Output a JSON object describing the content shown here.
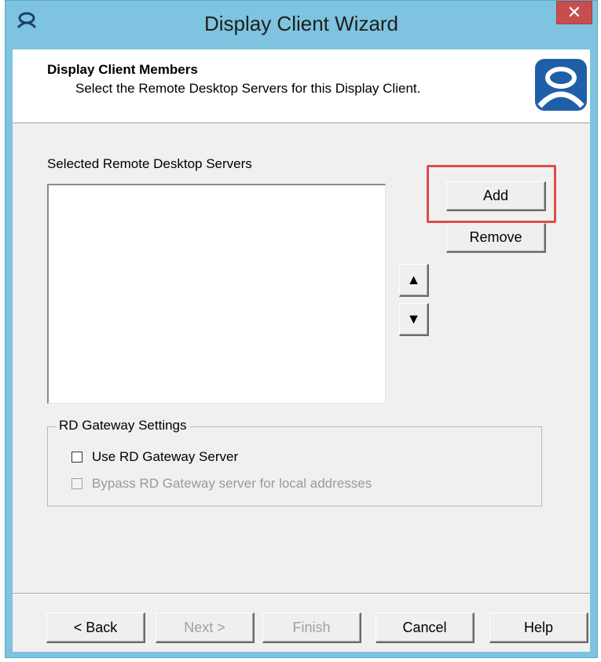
{
  "window": {
    "title": "Display Client Wizard",
    "close_symbol": "✕",
    "app_icon": "thinmanager-icon",
    "close_color": "#c74e4e",
    "titlebar_color": "#7ec3df"
  },
  "header": {
    "title": "Display Client Members",
    "subtitle": "Select the Remote Desktop Servers for this Display Client.",
    "logo": "thinmanager-logo"
  },
  "servers": {
    "label": "Selected Remote Desktop Servers",
    "items": []
  },
  "buttons": {
    "add": "Add",
    "remove": "Remove",
    "move_up": "▲",
    "move_down": "▼"
  },
  "highlight": {
    "target": "add-button",
    "color": "#e04a4a"
  },
  "gateway": {
    "label": "RD Gateway Settings",
    "use_gateway": {
      "label": "Use RD Gateway Server",
      "checked": false,
      "enabled": true
    },
    "bypass_local": {
      "label": "Bypass RD Gateway server for local addresses",
      "checked": false,
      "enabled": false
    }
  },
  "footer": {
    "back": "< Back",
    "next": "Next >",
    "finish": "Finish",
    "cancel": "Cancel",
    "help": "Help"
  }
}
